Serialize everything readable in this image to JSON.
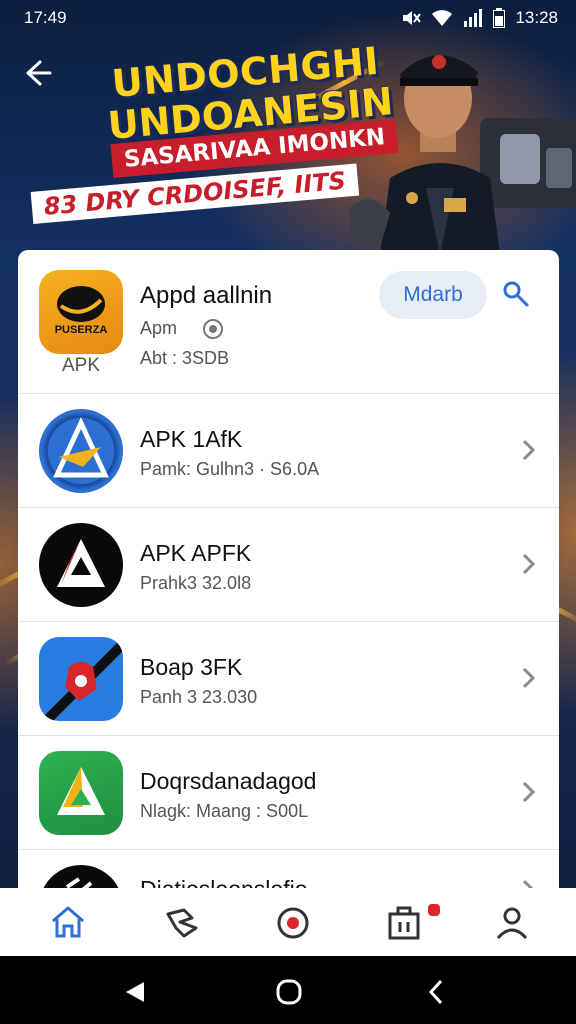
{
  "status_bar": {
    "time": "17:49",
    "clock_right": "13:28"
  },
  "banner": {
    "line1": "UNDOCHGHI",
    "line2": "UNDOANESIN",
    "subtitle": "SASARIVAA IMONKN",
    "tag": "83 DRY CRDOISEF, IITS"
  },
  "featured": {
    "icon_text": "PUSERZA",
    "icon_caption": "APK",
    "title": "Appd aallnin",
    "sub1": "Apm",
    "sub2": "Abt : 3SDB",
    "button": "Mdarb"
  },
  "apps": [
    {
      "title": "APK 1AfK",
      "meta": "Pamk: Gulhn3 · S6.0A",
      "icon": "blue-circle-a-icon"
    },
    {
      "title": "APK APFK",
      "meta": "Prahk3 32.0l8",
      "icon": "black-circle-a-icon"
    },
    {
      "title": "Boap 3FK",
      "meta": "Panh 3 23.030",
      "icon": "blue-red-shield-icon"
    },
    {
      "title": "Doqrsdanadagod",
      "meta": "Nlagk: Maang : S00L",
      "icon": "green-a-icon"
    },
    {
      "title": "Diatiosloonslofio",
      "meta": "",
      "icon": "black-app-icon"
    }
  ],
  "colors": {
    "accent": "#2f6fd6",
    "banner_yellow": "#ffd21c",
    "banner_red": "#c81e2b"
  }
}
